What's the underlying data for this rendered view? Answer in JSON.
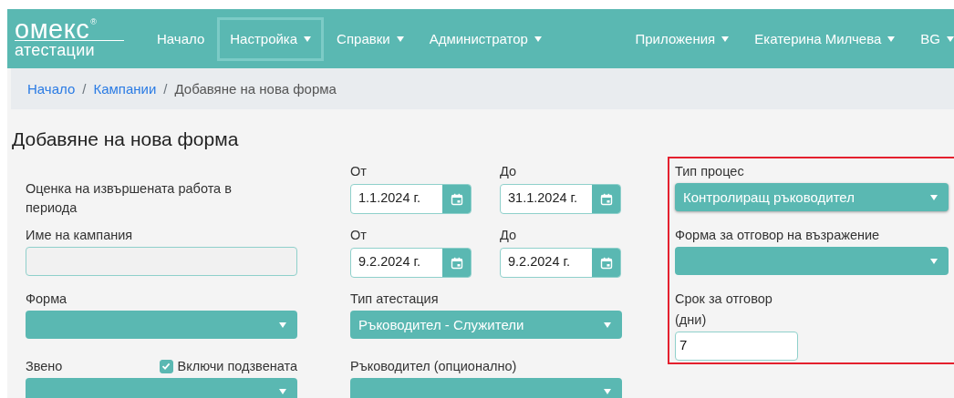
{
  "navbar": {
    "logo": {
      "brand": "омекс",
      "registered": "®",
      "product": "атестации"
    },
    "menu": [
      {
        "label": "Начало",
        "dropdown": false,
        "selected": false
      },
      {
        "label": "Настройка",
        "dropdown": true,
        "selected": true
      },
      {
        "label": "Справки",
        "dropdown": true,
        "selected": false
      },
      {
        "label": "Администратор",
        "dropdown": true,
        "selected": false
      }
    ],
    "right_menu": [
      {
        "label": "Приложения",
        "dropdown": true
      },
      {
        "label": "Екатерина Милчева",
        "dropdown": true
      },
      {
        "label": "BG",
        "dropdown": true
      }
    ]
  },
  "breadcrumb": {
    "separator": "/",
    "items": [
      {
        "label": "Начало",
        "link": true
      },
      {
        "label": "Кампании",
        "link": true
      },
      {
        "label": "Добавяне на нова форма",
        "link": false
      }
    ]
  },
  "page_title": "Добавяне на нова форма",
  "form": {
    "period": {
      "label": "Оценка на извършената работа в периода"
    },
    "period_dates": [
      {
        "label": "От",
        "value": "1.1.2024 г."
      },
      {
        "label": "До",
        "value": "31.1.2024 г."
      }
    ],
    "campaign_name": {
      "label": "Име на кампания",
      "disabled": true
    },
    "campaign_dates": [
      {
        "label": "От",
        "value": "9.2.2024 г."
      },
      {
        "label": "До",
        "value": "9.2.2024 г."
      }
    ],
    "form_select": {
      "label": "Форма"
    },
    "attestation_type": {
      "label": "Тип атестация",
      "value": "Ръководител - Служители"
    },
    "unit": {
      "label": "Звено",
      "include_subunits": {
        "label": "Включи подзвената",
        "checked": true
      }
    },
    "manager": {
      "label": "Ръководител (опционално)"
    },
    "process_settings": {
      "highlighted": true,
      "process_type": {
        "label": "Тип процес",
        "value": "Контролиращ ръководител"
      },
      "objection_form": {
        "label": "Форма за отговор на възражение"
      },
      "response_term": {
        "label": "Срок за отговор",
        "unit": "(дни)",
        "value": "7"
      }
    }
  }
}
